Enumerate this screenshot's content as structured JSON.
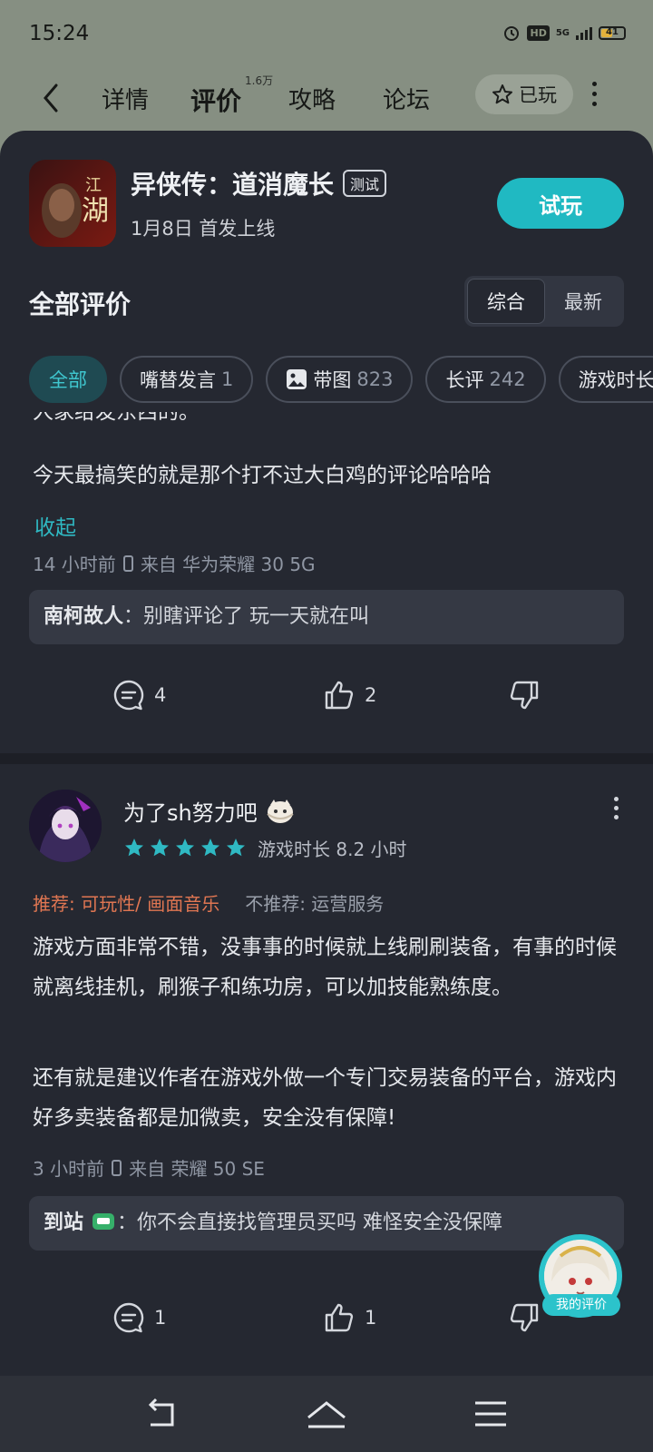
{
  "status": {
    "time": "15:24",
    "hd": "HD",
    "network": "5G",
    "battery": "41"
  },
  "nav": {
    "tabs": [
      {
        "label": "详情"
      },
      {
        "label": "评价"
      },
      {
        "label": "攻略"
      },
      {
        "label": "论坛"
      }
    ],
    "review_count_badge": "1.6万",
    "played_label": "已玩"
  },
  "game": {
    "title": "异侠传：道消魔长",
    "badge": "测试",
    "release": "1月8日  首发上线",
    "try_button": "试玩"
  },
  "reviews_header": {
    "title": "全部评价",
    "sort_options": [
      "综合",
      "最新"
    ],
    "selected_sort": "综合"
  },
  "filters": [
    {
      "label": "全部",
      "count": ""
    },
    {
      "label": "嘴替发言",
      "count": "1"
    },
    {
      "label": "带图",
      "count": "823"
    },
    {
      "label": "长评",
      "count": "242"
    },
    {
      "label": "游戏时长",
      "count": ""
    }
  ],
  "review1": {
    "text_partial": "人家给发东西的。",
    "text_line": "今天最搞笑的就是那个打不过大白鸡的评论哈哈哈",
    "collapse": "收起",
    "time": "14  小时前",
    "source": "来自  华为荣耀  30  5G",
    "reply_user": "南柯故人",
    "reply_text": "：别瞎评论了  玩一天就在叫",
    "comments": "4",
    "likes": "2"
  },
  "review2": {
    "username": "为了sh努力吧",
    "rating": 5,
    "playtime": "游戏时长  8.2  小时",
    "recommend": "推荐: 可玩性/  画面音乐",
    "not_recommend": "不推荐: 运营服务",
    "para1": "游戏方面非常不错，没事事的时候就上线刷刷装备，有事的时候就离线挂机，刷猴子和练功房，可以加技能熟练度。",
    "para2": "还有就是建议作者在游戏外做一个专门交易装备的平台，游戏内好多卖装备都是加微卖，安全没有保障!",
    "time": "3  小时前",
    "source": "来自  荣耀  50  SE",
    "reply_user": "到站",
    "reply_text": "：你不会直接找管理员买吗  难怪安全没保障",
    "comments": "1",
    "likes": "1"
  },
  "float_button": {
    "label": "我的评价"
  },
  "colors": {
    "accent": "#20b9c2",
    "sheet_bg": "#252831",
    "recommend": "#e07652",
    "star": "#2fb9c3"
  }
}
